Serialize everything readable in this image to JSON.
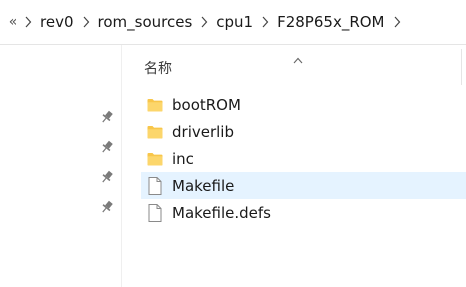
{
  "breadcrumb": {
    "overflow": "«",
    "segments": [
      "rev0",
      "rom_sources",
      "cpu1",
      "F28P65x_ROM"
    ]
  },
  "file_list": {
    "column_header": "名称",
    "items": [
      {
        "name": "bootROM",
        "type": "folder-icon"
      },
      {
        "name": "driverlib",
        "type": "folder-icon"
      },
      {
        "name": "inc",
        "type": "folder-icon"
      },
      {
        "name": "Makefile",
        "type": "file-icon",
        "selected": true
      },
      {
        "name": "Makefile.defs",
        "type": "file-icon"
      }
    ]
  },
  "nav_pane": {
    "pin_icons": [
      "pin-icon",
      "pin-icon",
      "pin-icon",
      "pin-icon"
    ]
  },
  "colors": {
    "folder": "#f8c64a",
    "selection": "#e5f3ff",
    "divider": "#e5e5e5"
  }
}
